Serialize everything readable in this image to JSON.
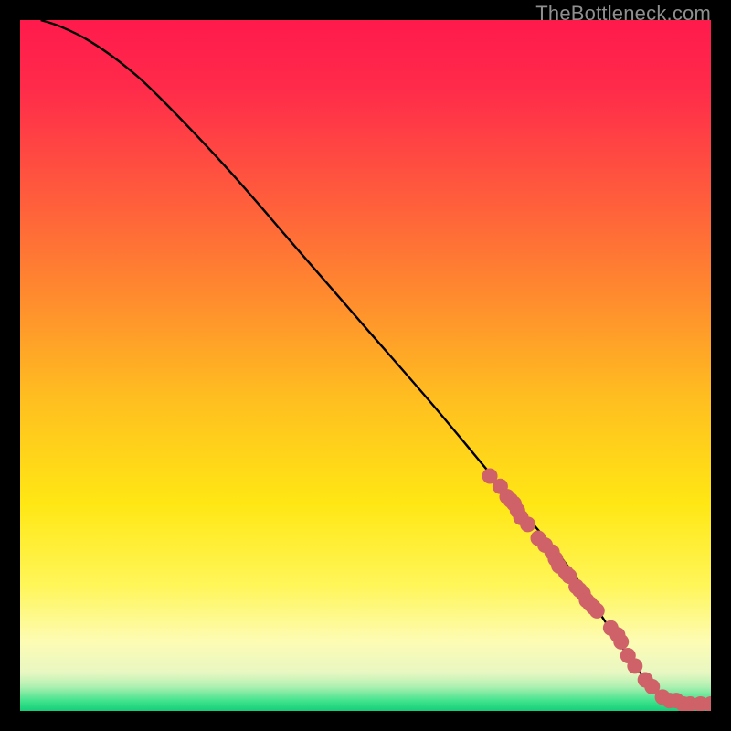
{
  "attribution": "TheBottleneck.com",
  "colors": {
    "gradient_stops": [
      {
        "offset": 0.0,
        "color": "#ff1a4c"
      },
      {
        "offset": 0.1,
        "color": "#ff2b4a"
      },
      {
        "offset": 0.25,
        "color": "#ff5a3d"
      },
      {
        "offset": 0.4,
        "color": "#ff8b2e"
      },
      {
        "offset": 0.55,
        "color": "#ffbf20"
      },
      {
        "offset": 0.7,
        "color": "#ffe714"
      },
      {
        "offset": 0.82,
        "color": "#fff65a"
      },
      {
        "offset": 0.9,
        "color": "#fdfcb4"
      },
      {
        "offset": 0.945,
        "color": "#e8f7c2"
      },
      {
        "offset": 0.965,
        "color": "#aef0b1"
      },
      {
        "offset": 0.985,
        "color": "#43e38e"
      },
      {
        "offset": 1.0,
        "color": "#13cf78"
      }
    ],
    "curve": "#000000",
    "dots": "#cf6168"
  },
  "chart_data": {
    "type": "line",
    "title": "",
    "xlabel": "",
    "ylabel": "",
    "xlim": [
      0,
      100
    ],
    "ylim": [
      0,
      100
    ],
    "grid": false,
    "legend": null,
    "series": [
      {
        "name": "curve",
        "x": [
          3,
          6,
          10,
          15,
          20,
          30,
          40,
          50,
          60,
          70,
          76,
          80,
          84,
          88,
          92,
          96,
          100
        ],
        "y": [
          100,
          99,
          97,
          93.5,
          89,
          78.5,
          67,
          55.5,
          44,
          32,
          25,
          20,
          14,
          8,
          3,
          1,
          1
        ]
      }
    ],
    "overlay_points": {
      "name": "dots",
      "x": [
        68,
        69.5,
        70.5,
        71,
        71.5,
        72,
        72.5,
        73.5,
        75,
        76,
        77,
        77.5,
        78,
        79,
        79.5,
        80.5,
        81,
        81.5,
        82,
        82.5,
        83,
        83.5,
        85.5,
        86.5,
        87,
        88,
        89,
        90.5,
        91.5,
        93,
        94,
        95,
        96,
        97,
        98.5,
        100
      ],
      "y": [
        34,
        32.5,
        31,
        30.5,
        30,
        29,
        28,
        27,
        25,
        24,
        23,
        22,
        21,
        20,
        19.5,
        18,
        17.5,
        17,
        16,
        15.5,
        15,
        14.5,
        12,
        11,
        10,
        8,
        6.5,
        4.5,
        3.5,
        2,
        1.5,
        1.5,
        1,
        1,
        1,
        1
      ]
    }
  }
}
